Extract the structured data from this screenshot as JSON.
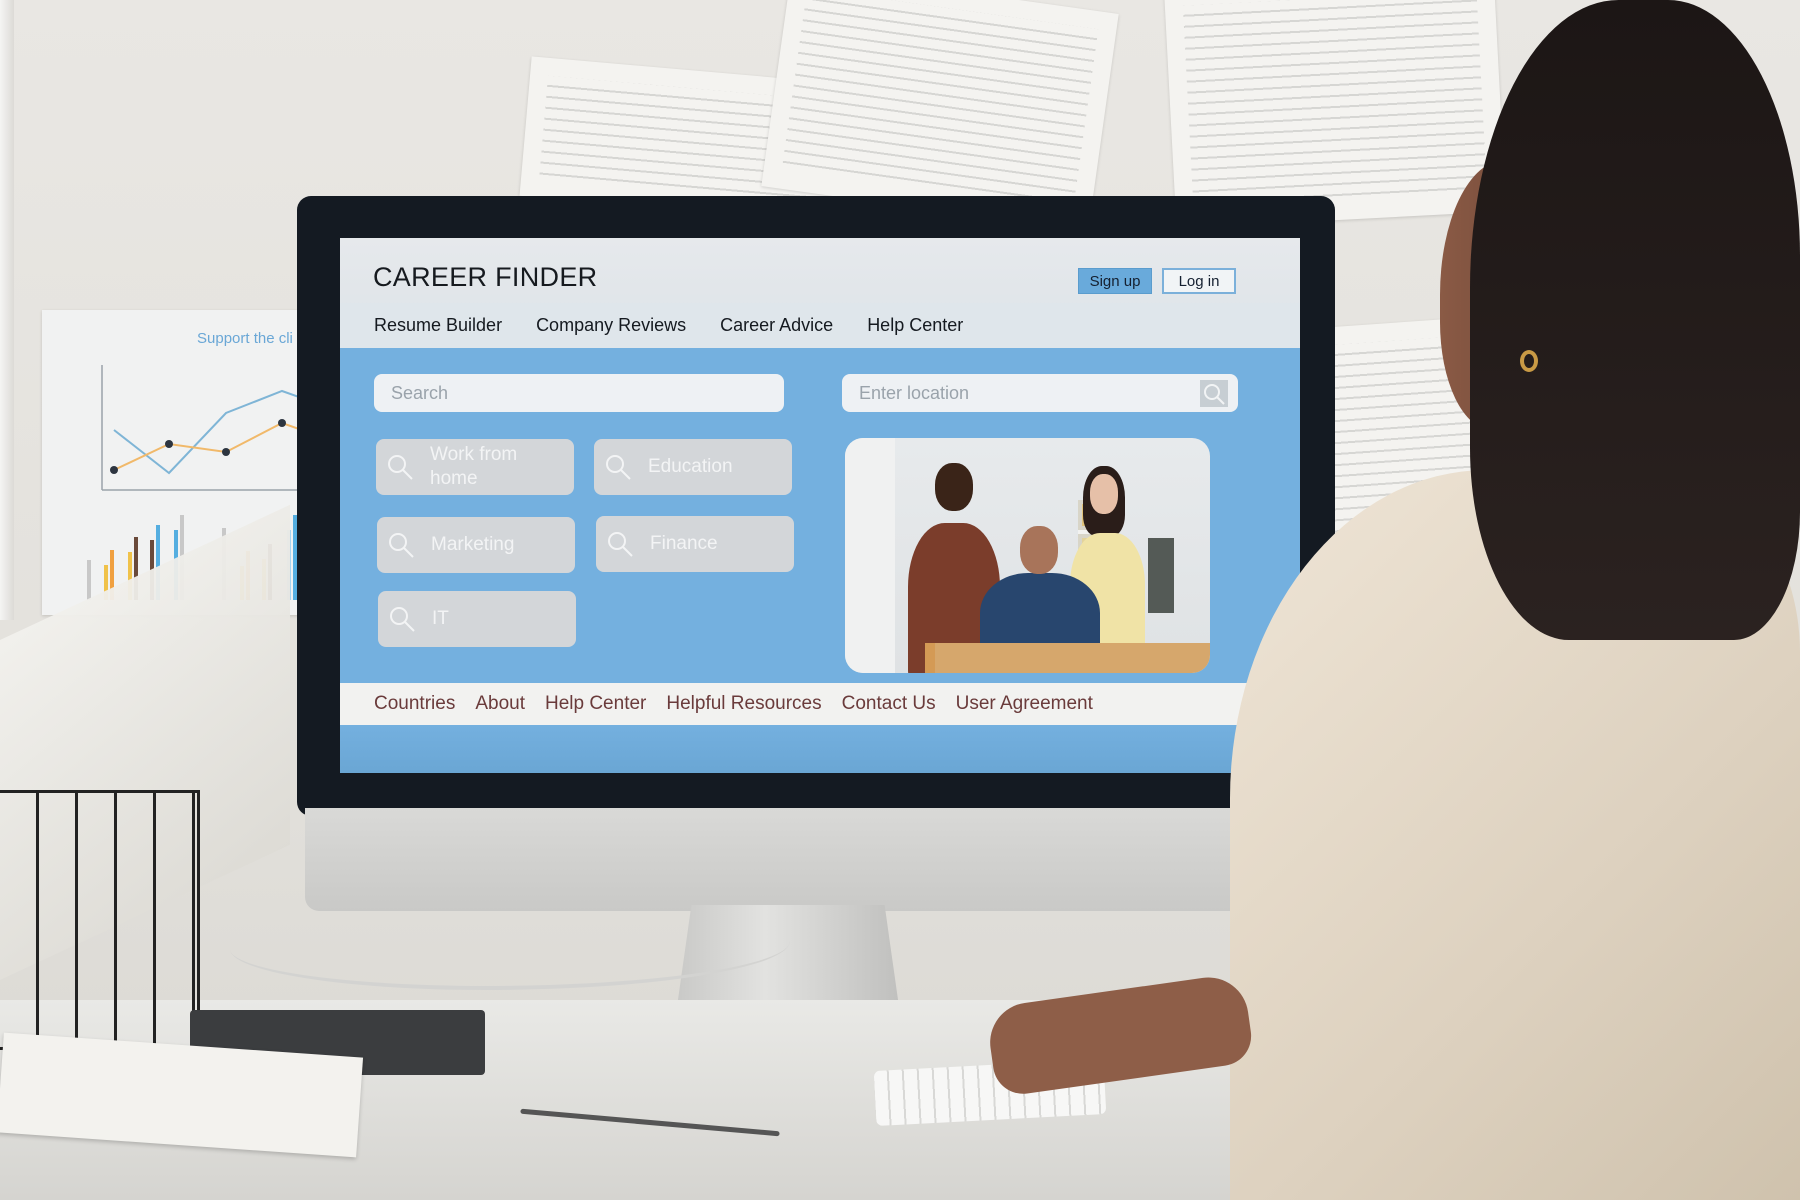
{
  "scene": {
    "poster_title": "Support the cli"
  },
  "site": {
    "brand": "CAREER FINDER",
    "header_buttons": {
      "signup_label": "Sign up",
      "login_label": "Log in"
    },
    "nav": [
      {
        "label": "Resume Builder"
      },
      {
        "label": "Company Reviews"
      },
      {
        "label": "Career Advice"
      },
      {
        "label": "Help Center"
      }
    ],
    "search": {
      "placeholder": "Search",
      "value": ""
    },
    "location": {
      "placeholder": "Enter location",
      "value": "",
      "icon": "search-icon"
    },
    "categories": [
      {
        "label": "Work from home",
        "icon": "search-icon"
      },
      {
        "label": "Education",
        "icon": "search-icon"
      },
      {
        "label": "Marketing",
        "icon": "search-icon"
      },
      {
        "label": "Finance",
        "icon": "search-icon"
      },
      {
        "label": "IT",
        "icon": "search-icon"
      }
    ],
    "hero_image": "team-photo",
    "footer": [
      {
        "label": "Countries"
      },
      {
        "label": "About"
      },
      {
        "label": "Help Center"
      },
      {
        "label": "Helpful Resources"
      },
      {
        "label": "Contact Us"
      },
      {
        "label": "User Agreement"
      }
    ],
    "colors": {
      "accent": "#69aadb",
      "page_background": "#74b0df",
      "header_background": "#e3e7eb",
      "footer_text": "#6a3b3b",
      "category_tile": "#d3d6d9"
    }
  }
}
